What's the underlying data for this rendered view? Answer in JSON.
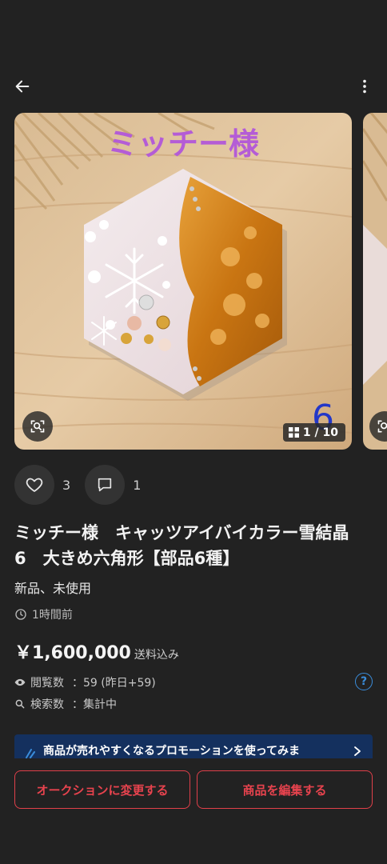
{
  "header": {
    "back_icon": "arrow-left-icon",
    "more_icon": "more-vertical-icon"
  },
  "gallery": {
    "counter": "1 / 10",
    "photo_caption": "ミッチー様",
    "photo_number": "6",
    "scan_icon": "image-search-icon",
    "counter_icon": "grid-icon"
  },
  "actions": {
    "like_icon": "heart-icon",
    "like_count": "3",
    "comment_icon": "comment-icon",
    "comment_count": "1"
  },
  "item": {
    "title": "ミッチー様　キャッツアイバイカラー雪結晶　6　大きめ六角形【部品6種】",
    "condition": "新品、未使用",
    "posted": "1時間前",
    "price": "￥1,600,000",
    "shipping": "送料込み"
  },
  "stats": {
    "views_label": "閲覧数",
    "views_value": "：59 (昨日+59)",
    "searches_label": "検索数",
    "searches_value": "：集計中",
    "help_label": "?"
  },
  "promo": {
    "text": "商品が売れやすくなるプロモーションを使ってみま"
  },
  "buttons": {
    "auction": "オークションに変更する",
    "edit": "商品を編集する"
  },
  "colors": {
    "background": "#222222",
    "accent_red": "#e8434e",
    "promo_bg": "#14305e",
    "link_blue": "#3a8ddb"
  }
}
